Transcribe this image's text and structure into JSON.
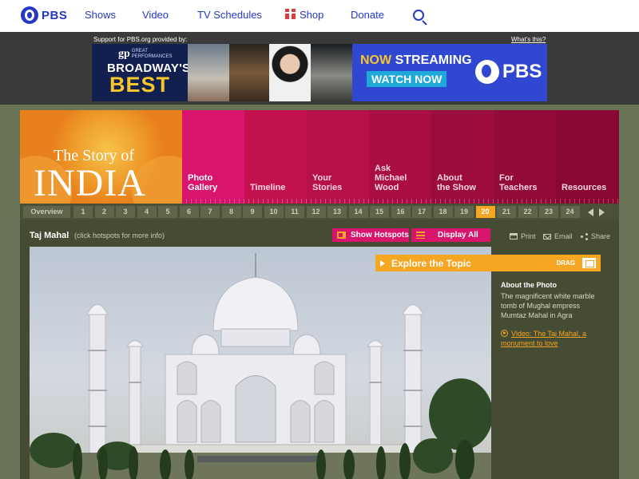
{
  "colors": {
    "pbs_blue": "#2638c4",
    "accent_orange": "#f5a623",
    "hotspot_magenta": "#d8146d",
    "frame_olive": "#454c33"
  },
  "topnav": {
    "logo": "PBS",
    "links": [
      "Shows",
      "Video",
      "TV Schedules",
      "Shop",
      "Donate"
    ],
    "shop_icon": "gift-icon",
    "search_icon": "search-icon"
  },
  "sponsor": {
    "label": "Support for PBS.org provided by:",
    "whats_this": "What's this?",
    "ad": {
      "badge": "GREAT PERFORMANCES",
      "badge_mark": "gp",
      "line1": "BROADWAY'S",
      "line2": "BEST",
      "now": "NOW",
      "streaming": "STREAMING",
      "watch": "WATCH NOW",
      "brand": "PBS"
    }
  },
  "hero": {
    "line1": "The Story of",
    "line2": "INDIA"
  },
  "sections": [
    {
      "label": "Photo\nGallery",
      "color": "#d8146d",
      "active": true
    },
    {
      "label": "Timeline",
      "color": "#c3124f",
      "active": false
    },
    {
      "label": "Your\nStories",
      "color": "#b51049",
      "active": false
    },
    {
      "label": "Ask\nMichael\nWood",
      "color": "#a90d43",
      "active": false
    },
    {
      "label": "About\nthe Show",
      "color": "#9c0b3d",
      "active": false
    },
    {
      "label": "For\nTeachers",
      "color": "#920a38",
      "active": false
    },
    {
      "label": "Resources",
      "color": "#880833",
      "active": false
    }
  ],
  "pager": {
    "overview": "Overview",
    "pages": [
      "1",
      "2",
      "3",
      "4",
      "5",
      "6",
      "7",
      "8",
      "9",
      "10",
      "11",
      "12",
      "13",
      "14",
      "15",
      "16",
      "17",
      "18",
      "19",
      "20",
      "21",
      "22",
      "23",
      "24"
    ],
    "current": "20"
  },
  "gallery": {
    "title": "Taj Mahal",
    "hint": "(click hotspots for more info)",
    "show_hotspots": "Show Hotspots",
    "display_all": "Display All",
    "print": "Print",
    "email": "Email",
    "share": "Share"
  },
  "sidebar": {
    "explore": "Explore the Topic",
    "drag": "DRAG",
    "about_title": "About the Photo",
    "about_text": "The magnificent white marble tomb of Mughal empress Mumtaz Mahal in Agra",
    "video_link": "Video: The Taj Mahal, a monument to love"
  }
}
